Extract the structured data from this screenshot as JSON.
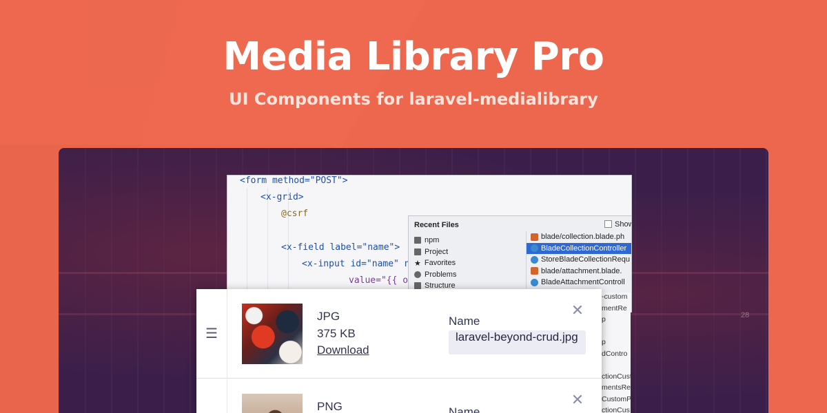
{
  "hero": {
    "title": "Media Library Pro",
    "subtitle": "UI Components for laravel-medialibrary"
  },
  "background": {
    "panel_number": "28"
  },
  "editor": {
    "lines": [
      "<form method=\"POST\">",
      "<x-grid>",
      "@csrf",
      "<x-field label=\"name\">",
      "<x-input id=\"name\" na",
      "value=\"{{ o"
    ],
    "recent_files": {
      "title": "Recent Files",
      "show_label": "Show",
      "left_items": [
        "npm",
        "Project",
        "Favorites",
        "Problems",
        "Structure"
      ],
      "right_items": [
        "blade/collection.blade.ph",
        "BladeCollectionController",
        "StoreBladeCollectionRequ",
        "blade/attachment.blade.",
        "BladeAttachmentControll"
      ],
      "selected_index": 1
    },
    "side_fragments": [
      "-custom",
      "mentRe",
      "p",
      "",
      "p",
      "dContro",
      "",
      "ctionCust",
      "mentsRe",
      "CustomPr",
      "ctionCus"
    ]
  },
  "media_items": [
    {
      "type": "JPG",
      "size": "375 KB",
      "download_label": "Download",
      "name_label": "Name",
      "name_value": "laravel-beyond-crud.jpg"
    },
    {
      "type": "PNG",
      "name_label": "Name"
    }
  ],
  "icons": {
    "drag_handle": "☰",
    "close": "✕"
  }
}
